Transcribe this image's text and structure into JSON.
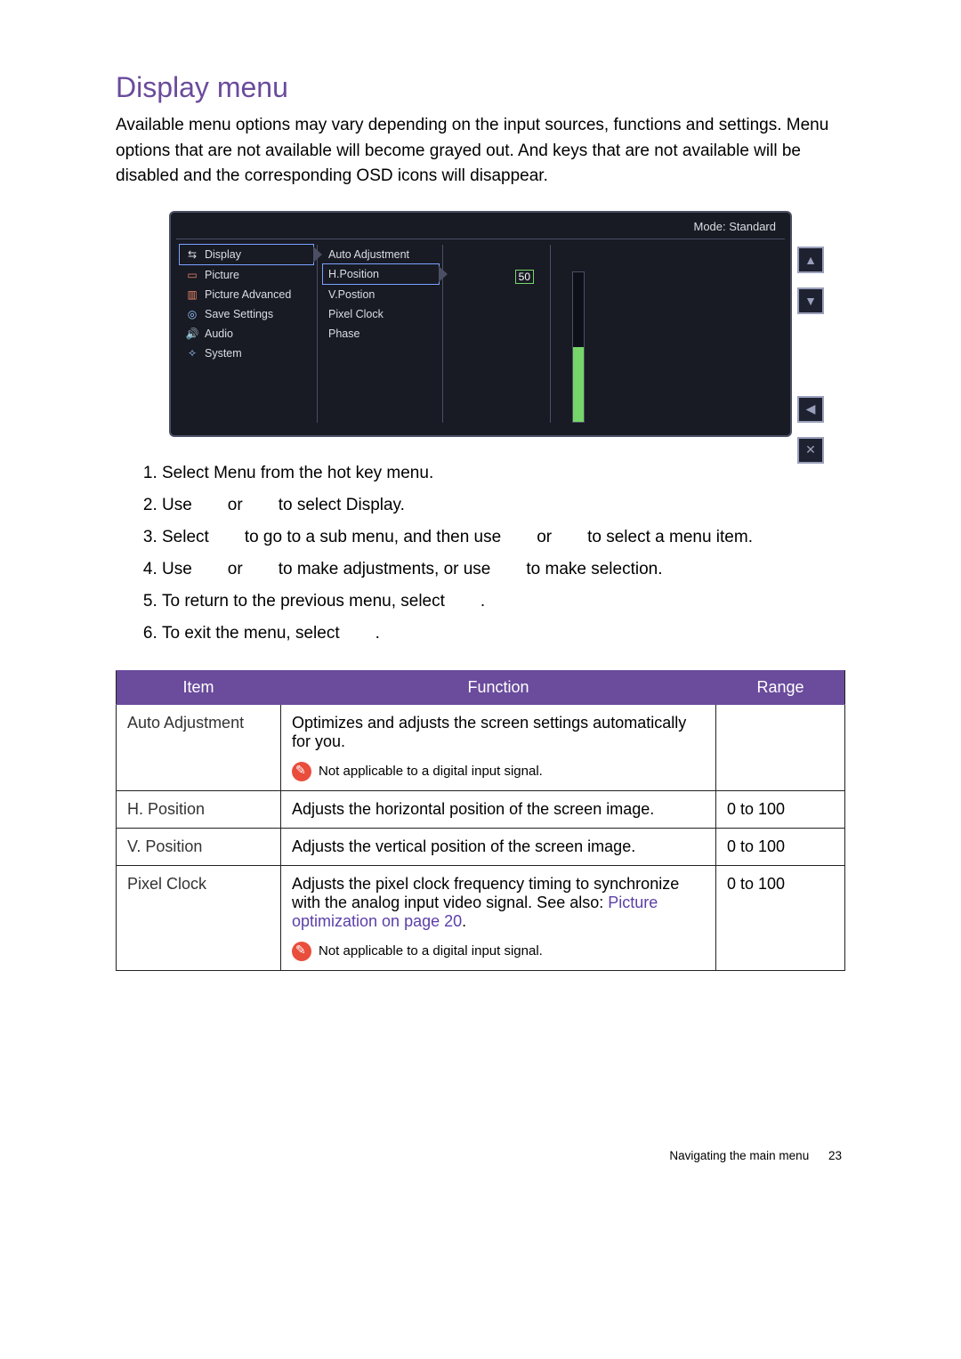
{
  "title": "Display menu",
  "intro": "Available menu options may vary depending on the input sources, functions and settings. Menu options that are not available will become grayed out. And keys that are not available will be disabled and the corresponding OSD icons will disappear.",
  "osd": {
    "mode_prefix": "Mode: ",
    "mode_value": "Standard",
    "value_label": "50",
    "left_menu": [
      {
        "icon": "display-icon",
        "label": "Display",
        "selected": true
      },
      {
        "icon": "picture-icon",
        "label": "Picture",
        "selected": false
      },
      {
        "icon": "picadv-icon",
        "label": "Picture Advanced",
        "selected": false
      },
      {
        "icon": "save-icon",
        "label": "Save Settings",
        "selected": false
      },
      {
        "icon": "audio-icon",
        "label": "Audio",
        "selected": false
      },
      {
        "icon": "system-icon",
        "label": "System",
        "selected": false
      }
    ],
    "sub_menu": [
      {
        "label": "Auto Adjustment",
        "selected": false
      },
      {
        "label": "H.Position",
        "selected": true
      },
      {
        "label": "V.Postion",
        "selected": false
      },
      {
        "label": "Pixel Clock",
        "selected": false
      },
      {
        "label": "Phase",
        "selected": false
      }
    ],
    "buttons": {
      "up": "▲",
      "down": "▼",
      "back": "◀",
      "exit": "✕"
    }
  },
  "steps": {
    "s1a": "Select ",
    "s1b": "Menu",
    "s1c": " from the hot key menu.",
    "s2a": "Use",
    "s2b": "or",
    "s2c": "to select ",
    "s2d": "Display",
    "s2e": ".",
    "s3a": "Select",
    "s3b": "to go to a sub menu, and then use",
    "s3c": "or",
    "s3d": "to select a menu item.",
    "s4a": "Use",
    "s4b": "or",
    "s4c": "to make adjustments, or use",
    "s4d": "to make selection.",
    "s5a": "To return to the previous menu, select",
    "s5b": ".",
    "s6a": "To exit the menu, select",
    "s6b": "."
  },
  "table": {
    "headers": {
      "item": "Item",
      "function": "Function",
      "range": "Range"
    },
    "rows": [
      {
        "item": "Auto Adjustment",
        "func": "Optimizes and adjusts the screen settings automatically for you.",
        "note": "Not applicable to a digital input signal.",
        "range": ""
      },
      {
        "item": "H. Position",
        "func": "Adjusts the horizontal position of the screen image.",
        "range": "0 to 100"
      },
      {
        "item": "V. Position",
        "func": "Adjusts the vertical position of the screen image.",
        "range": "0 to 100"
      },
      {
        "item": "Pixel Clock",
        "func": "Adjusts the pixel clock frequency timing to synchronize with the analog input video signal. See also: ",
        "link": "Picture optimization on page 20",
        "func_tail": ".",
        "note": "Not applicable to a digital input signal.",
        "range": "0 to 100"
      }
    ]
  },
  "footer": {
    "text": "Navigating the main menu",
    "page": "23"
  }
}
